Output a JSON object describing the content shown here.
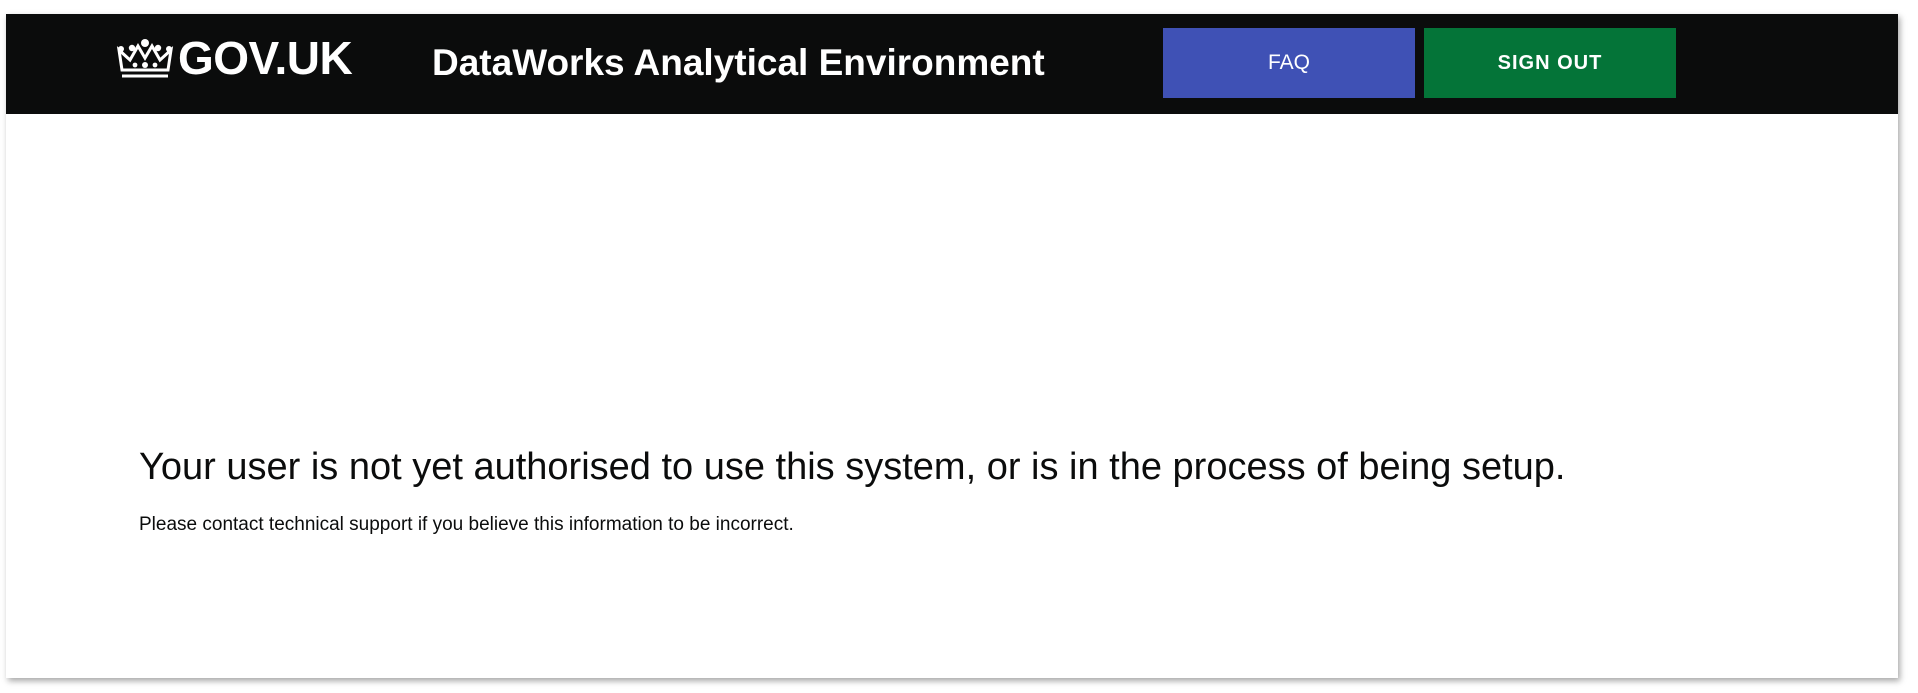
{
  "header": {
    "brand": {
      "icon": "crown-icon",
      "label": "GOV.UK"
    },
    "service_name": "DataWorks Analytical Environment",
    "faq_label": "FAQ",
    "sign_out_label": "SIGN OUT"
  },
  "main": {
    "headline": "Your user is not yet authorised to use this system, or is in the process of being setup.",
    "message": "Please contact technical support if you believe this information to be incorrect."
  },
  "colors": {
    "header_background": "#0b0c0c",
    "faq_button": "#3f51b5",
    "sign_out_button": "#047438"
  }
}
